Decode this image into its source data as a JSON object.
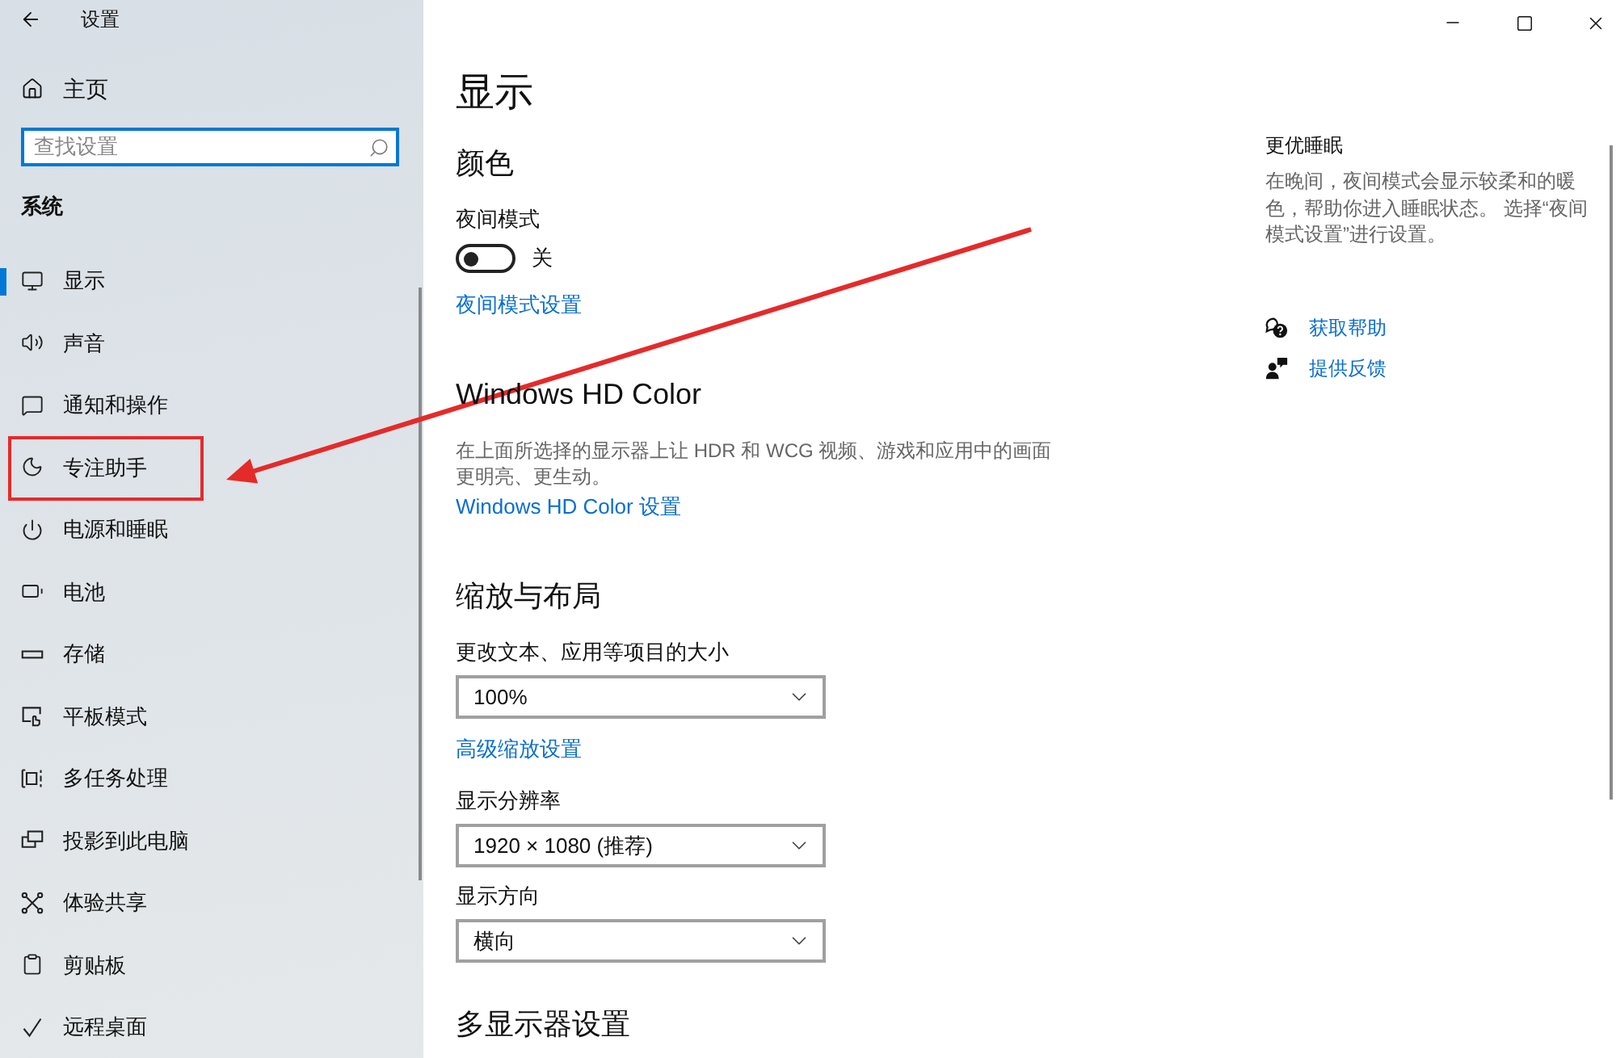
{
  "window": {
    "title": "设置"
  },
  "sidebar": {
    "home": "主页",
    "search": {
      "placeholder": "查找设置"
    },
    "section": "系统",
    "items": [
      {
        "label": "显示",
        "kind": "display",
        "selected": true,
        "annotated": false
      },
      {
        "label": "声音",
        "kind": "sound",
        "selected": false,
        "annotated": false
      },
      {
        "label": "通知和操作",
        "kind": "notifications",
        "selected": false,
        "annotated": false
      },
      {
        "label": "专注助手",
        "kind": "focus",
        "selected": false,
        "annotated": true
      },
      {
        "label": "电源和睡眠",
        "kind": "power",
        "selected": false,
        "annotated": false
      },
      {
        "label": "电池",
        "kind": "battery",
        "selected": false,
        "annotated": false
      },
      {
        "label": "存储",
        "kind": "storage",
        "selected": false,
        "annotated": false
      },
      {
        "label": "平板模式",
        "kind": "tablet",
        "selected": false,
        "annotated": false
      },
      {
        "label": "多任务处理",
        "kind": "multitasking",
        "selected": false,
        "annotated": false
      },
      {
        "label": "投影到此电脑",
        "kind": "projecting",
        "selected": false,
        "annotated": false
      },
      {
        "label": "体验共享",
        "kind": "shared",
        "selected": false,
        "annotated": false
      },
      {
        "label": "剪贴板",
        "kind": "clipboard",
        "selected": false,
        "annotated": false
      },
      {
        "label": "远程桌面",
        "kind": "remote",
        "selected": false,
        "annotated": false
      }
    ]
  },
  "page": {
    "title": "显示",
    "sections": [
      {
        "heading": "颜色",
        "items": [
          {
            "kind": "label",
            "text": "夜间模式"
          },
          {
            "kind": "toggle",
            "on": false,
            "state_text": "关"
          },
          {
            "kind": "link",
            "text": "夜间模式设置"
          }
        ]
      },
      {
        "heading": "Windows HD Color",
        "items": [
          {
            "kind": "text",
            "text": "在上面所选择的显示器上让 HDR 和 WCG 视频、游戏和应用中的画面更明亮、更生动。"
          },
          {
            "kind": "link",
            "text": "Windows HD Color 设置"
          }
        ]
      },
      {
        "heading": "缩放与布局",
        "items": [
          {
            "kind": "label",
            "text": "更改文本、应用等项目的大小"
          },
          {
            "kind": "dropdown",
            "value": "100%"
          },
          {
            "kind": "link",
            "text": "高级缩放设置"
          },
          {
            "kind": "label",
            "text": "显示分辨率"
          },
          {
            "kind": "dropdown",
            "value": "1920 × 1080 (推荐)"
          },
          {
            "kind": "label",
            "text": "显示方向"
          },
          {
            "kind": "dropdown",
            "value": "横向"
          }
        ]
      },
      {
        "heading": "多显示器设置"
      }
    ]
  },
  "related": {
    "heading": "更优睡眠",
    "text": "在晚间，夜间模式会显示较柔和的暖色，帮助你进入睡眠状态。 选择“夜间模式设置”进行设置。",
    "links": [
      {
        "kind": "help",
        "text": "获取帮助"
      },
      {
        "kind": "feedback",
        "text": "提供反馈"
      }
    ]
  }
}
